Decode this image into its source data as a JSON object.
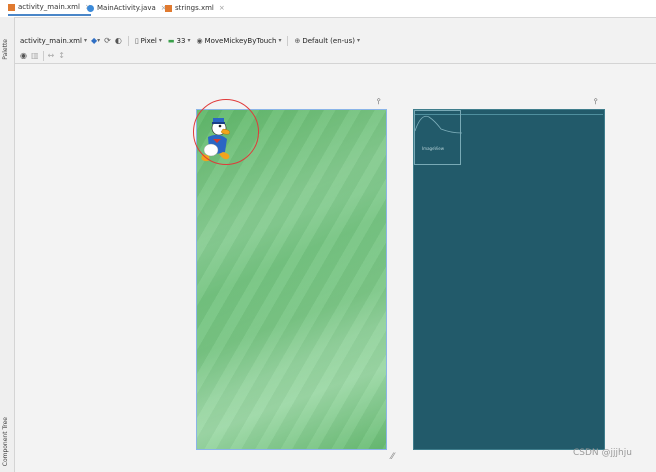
{
  "tabs": [
    {
      "label": "activity_main.xml",
      "icon": "xml-file-icon",
      "active": true
    },
    {
      "label": "MainActivity.java",
      "icon": "java-class-icon",
      "active": false
    },
    {
      "label": "strings.xml",
      "icon": "xml-file-icon",
      "active": false
    }
  ],
  "tab_close_glyph": "×",
  "side_panels": {
    "palette": "Palette",
    "component_tree": "Component Tree"
  },
  "toolbar": {
    "file": "activity_main.xml",
    "device": "Pixel",
    "api": "33",
    "theme": "MoveMickeyByTouch",
    "locale": "Default (en-us)"
  },
  "blueprint": {
    "image_label": "ImageView"
  },
  "watermark": "CSDN @jjjhju",
  "colors": {
    "design_background": "#6cc078",
    "blueprint_background": "#225a6a",
    "selection_circle": "#e03a3a",
    "active_tab_underline": "#4a86c8"
  }
}
